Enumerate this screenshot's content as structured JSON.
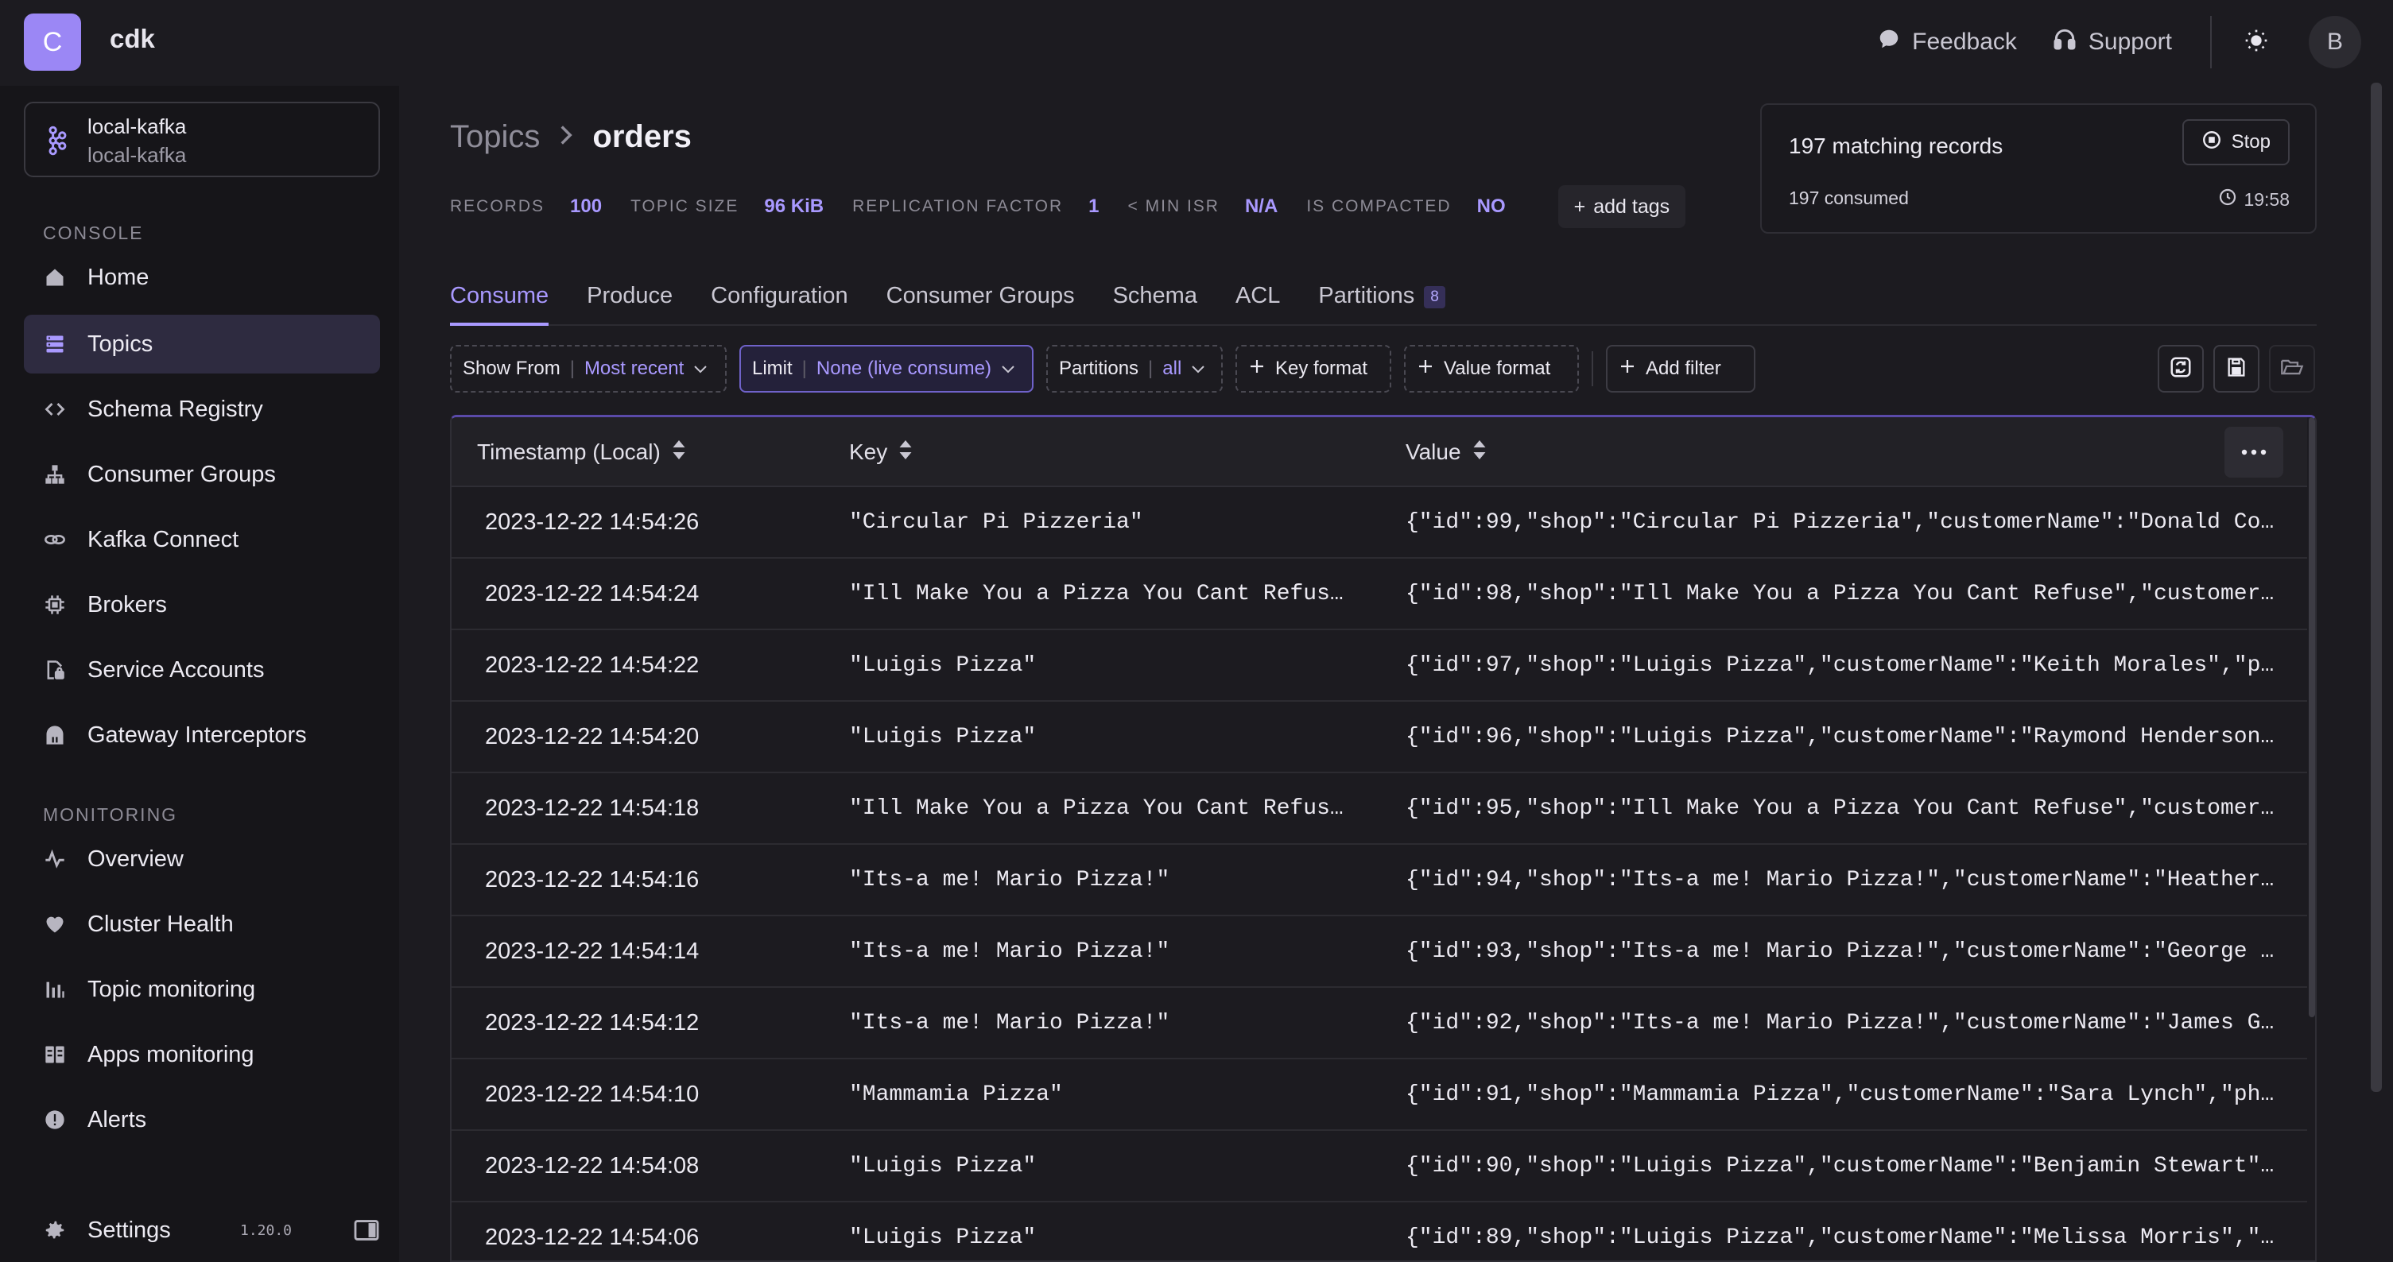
{
  "app": {
    "logo_letter": "C",
    "title": "cdk"
  },
  "topbar": {
    "feedback_label": "Feedback",
    "support_label": "Support",
    "avatar_letter": "B"
  },
  "sidebar": {
    "cluster": {
      "name": "local-kafka",
      "sub": "local-kafka"
    },
    "console_label": "CONSOLE",
    "console_items": [
      {
        "label": "Home",
        "icon": "home-icon"
      },
      {
        "label": "Topics",
        "icon": "topics-icon"
      },
      {
        "label": "Schema Registry",
        "icon": "code-icon"
      },
      {
        "label": "Consumer Groups",
        "icon": "hierarchy-icon"
      },
      {
        "label": "Kafka Connect",
        "icon": "link-icon"
      },
      {
        "label": "Brokers",
        "icon": "cpu-icon"
      },
      {
        "label": "Service Accounts",
        "icon": "lock-file-icon"
      },
      {
        "label": "Gateway Interceptors",
        "icon": "gateway-icon"
      }
    ],
    "monitoring_label": "MONITORING",
    "monitoring_items": [
      {
        "label": "Overview",
        "icon": "pulse-icon"
      },
      {
        "label": "Cluster Health",
        "icon": "heart-icon"
      },
      {
        "label": "Topic monitoring",
        "icon": "bar-chart-icon"
      },
      {
        "label": "Apps monitoring",
        "icon": "apps-icon"
      },
      {
        "label": "Alerts",
        "icon": "alert-icon"
      }
    ],
    "settings_label": "Settings",
    "version": "1.20.0"
  },
  "breadcrumb": {
    "parent": "Topics",
    "current": "orders"
  },
  "stats": {
    "records_label": "RECORDS",
    "records_value": "100",
    "size_label": "TOPIC SIZE",
    "size_value": "96 KiB",
    "replication_label": "REPLICATION FACTOR",
    "replication_value": "1",
    "isr_label": "< MIN ISR",
    "isr_value": "N/A",
    "compacted_label": "IS COMPACTED",
    "compacted_value": "NO",
    "add_tags_label": "add tags"
  },
  "status": {
    "matching": "197 matching records",
    "consumed": "197 consumed",
    "stop_label": "Stop",
    "time": "19:58"
  },
  "tabs": [
    {
      "label": "Consume"
    },
    {
      "label": "Produce"
    },
    {
      "label": "Configuration"
    },
    {
      "label": "Consumer Groups"
    },
    {
      "label": "Schema"
    },
    {
      "label": "ACL"
    },
    {
      "label": "Partitions",
      "badge": "8"
    }
  ],
  "toolbar": {
    "show_from_label": "Show From",
    "show_from_value": "Most recent",
    "limit_label": "Limit",
    "limit_value": "None (live consume)",
    "partitions_label": "Partitions",
    "partitions_value": "all",
    "key_format_label": "Key format",
    "value_format_label": "Value format",
    "add_filter_label": "Add filter"
  },
  "table": {
    "columns": [
      "Timestamp (Local)",
      "Key",
      "Value"
    ],
    "rows": [
      {
        "ts": "2023-12-22 14:54:26",
        "key": "\"Circular Pi Pizzeria\"",
        "value": "{\"id\":99,\"shop\":\"Circular Pi Pizzeria\",\"customerName\":\"Donald Co…"
      },
      {
        "ts": "2023-12-22 14:54:24",
        "key": "\"Ill Make You a Pizza You Cant Refus…",
        "value": "{\"id\":98,\"shop\":\"Ill Make You a Pizza You Cant Refuse\",\"customer…"
      },
      {
        "ts": "2023-12-22 14:54:22",
        "key": "\"Luigis Pizza\"",
        "value": "{\"id\":97,\"shop\":\"Luigis Pizza\",\"customerName\":\"Keith Morales\",\"p…"
      },
      {
        "ts": "2023-12-22 14:54:20",
        "key": "\"Luigis Pizza\"",
        "value": "{\"id\":96,\"shop\":\"Luigis Pizza\",\"customerName\":\"Raymond Henderson…"
      },
      {
        "ts": "2023-12-22 14:54:18",
        "key": "\"Ill Make You a Pizza You Cant Refus…",
        "value": "{\"id\":95,\"shop\":\"Ill Make You a Pizza You Cant Refuse\",\"customer…"
      },
      {
        "ts": "2023-12-22 14:54:16",
        "key": "\"Its-a me! Mario Pizza!\"",
        "value": "{\"id\":94,\"shop\":\"Its-a me! Mario Pizza!\",\"customerName\":\"Heather…"
      },
      {
        "ts": "2023-12-22 14:54:14",
        "key": "\"Its-a me! Mario Pizza!\"",
        "value": "{\"id\":93,\"shop\":\"Its-a me! Mario Pizza!\",\"customerName\":\"George …"
      },
      {
        "ts": "2023-12-22 14:54:12",
        "key": "\"Its-a me! Mario Pizza!\"",
        "value": "{\"id\":92,\"shop\":\"Its-a me! Mario Pizza!\",\"customerName\":\"James G…"
      },
      {
        "ts": "2023-12-22 14:54:10",
        "key": "\"Mammamia Pizza\"",
        "value": "{\"id\":91,\"shop\":\"Mammamia Pizza\",\"customerName\":\"Sara Lynch\",\"ph…"
      },
      {
        "ts": "2023-12-22 14:54:08",
        "key": "\"Luigis Pizza\"",
        "value": "{\"id\":90,\"shop\":\"Luigis Pizza\",\"customerName\":\"Benjamin Stewart\"…"
      },
      {
        "ts": "2023-12-22 14:54:06",
        "key": "\"Luigis Pizza\"",
        "value": "{\"id\":89,\"shop\":\"Luigis Pizza\",\"customerName\":\"Melissa Morris\",\"…"
      }
    ]
  },
  "colors": {
    "accent": "#a999ff",
    "logo": "#9b87f5",
    "active_nav": "#2e2b40"
  }
}
